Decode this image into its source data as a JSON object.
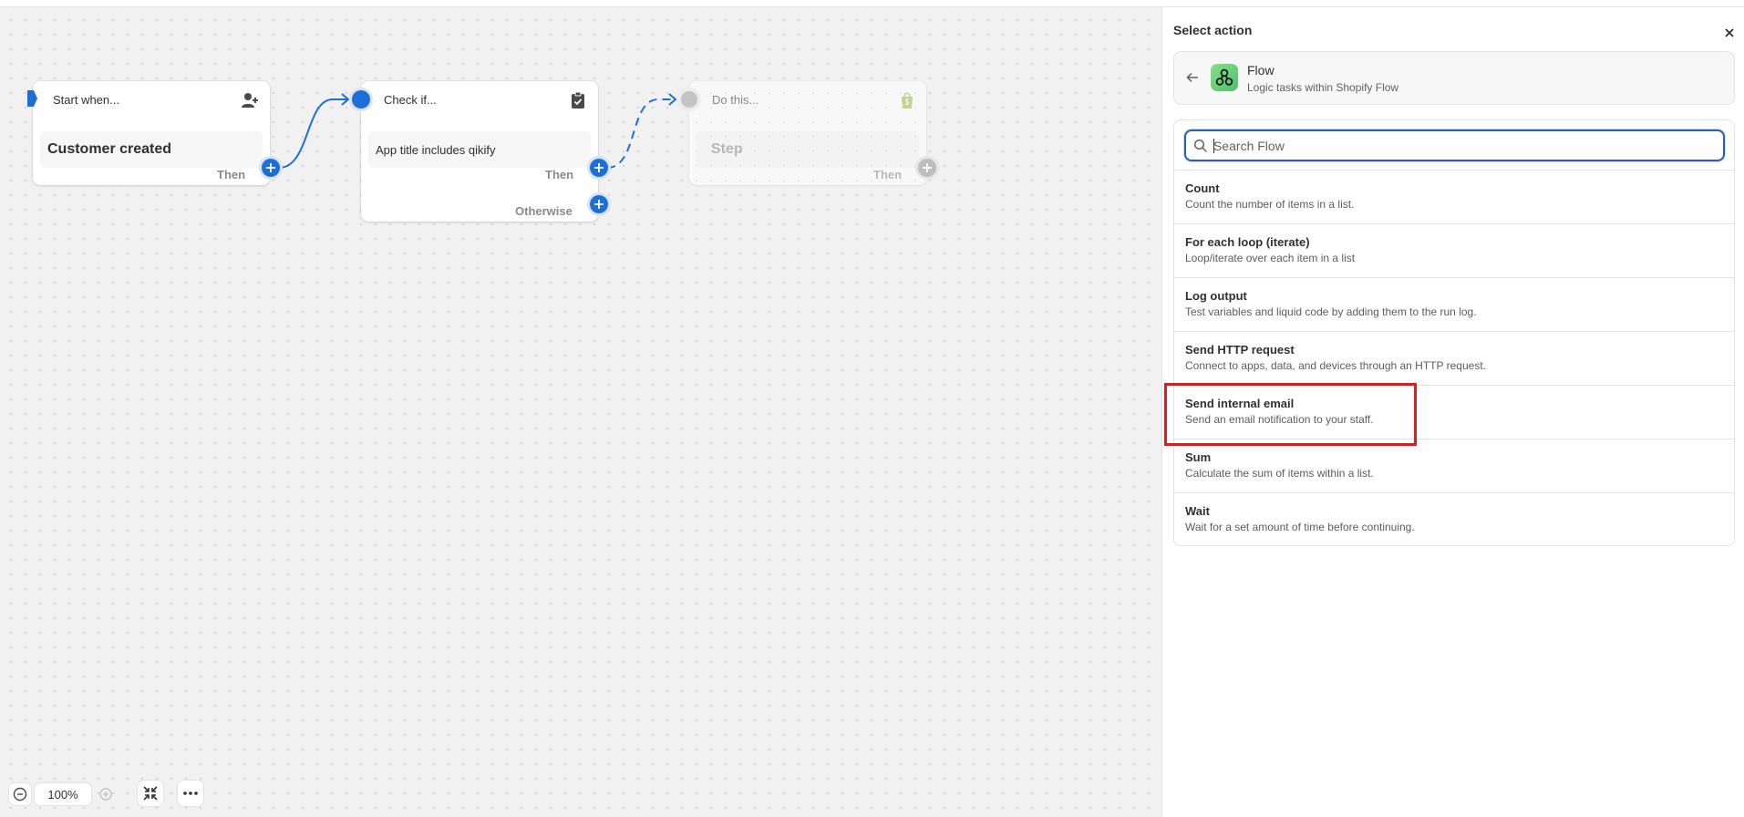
{
  "canvas": {
    "trigger_card": {
      "header": "Start when...",
      "value": "Customer created",
      "then_label": "Then"
    },
    "condition_card": {
      "header": "Check if...",
      "value": "App title includes qikify",
      "then_label": "Then",
      "otherwise_label": "Otherwise"
    },
    "action_card": {
      "header": "Do this...",
      "value": "Step",
      "then_label": "Then"
    },
    "zoom": {
      "level": "100%"
    }
  },
  "panel": {
    "title": "Select action",
    "app": {
      "name": "Flow",
      "description": "Logic tasks within Shopify Flow"
    },
    "search": {
      "placeholder": "Search Flow",
      "value": ""
    },
    "items": [
      {
        "title": "Count",
        "description": "Count the number of items in a list."
      },
      {
        "title": "For each loop (iterate)",
        "description": "Loop/iterate over each item in a list"
      },
      {
        "title": "Log output",
        "description": "Test variables and liquid code by adding them to the run log."
      },
      {
        "title": "Send HTTP request",
        "description": "Connect to apps, data, and devices through an HTTP request."
      },
      {
        "title": "Send internal email",
        "description": "Send an email notification to your staff."
      },
      {
        "title": "Sum",
        "description": "Calculate the sum of items within a list."
      },
      {
        "title": "Wait",
        "description": "Wait for a set amount of time before continuing."
      }
    ]
  },
  "colors": {
    "accent": "#1d6fd7",
    "highlight": "#e01b1b",
    "shopify_green": "#95bf47"
  }
}
